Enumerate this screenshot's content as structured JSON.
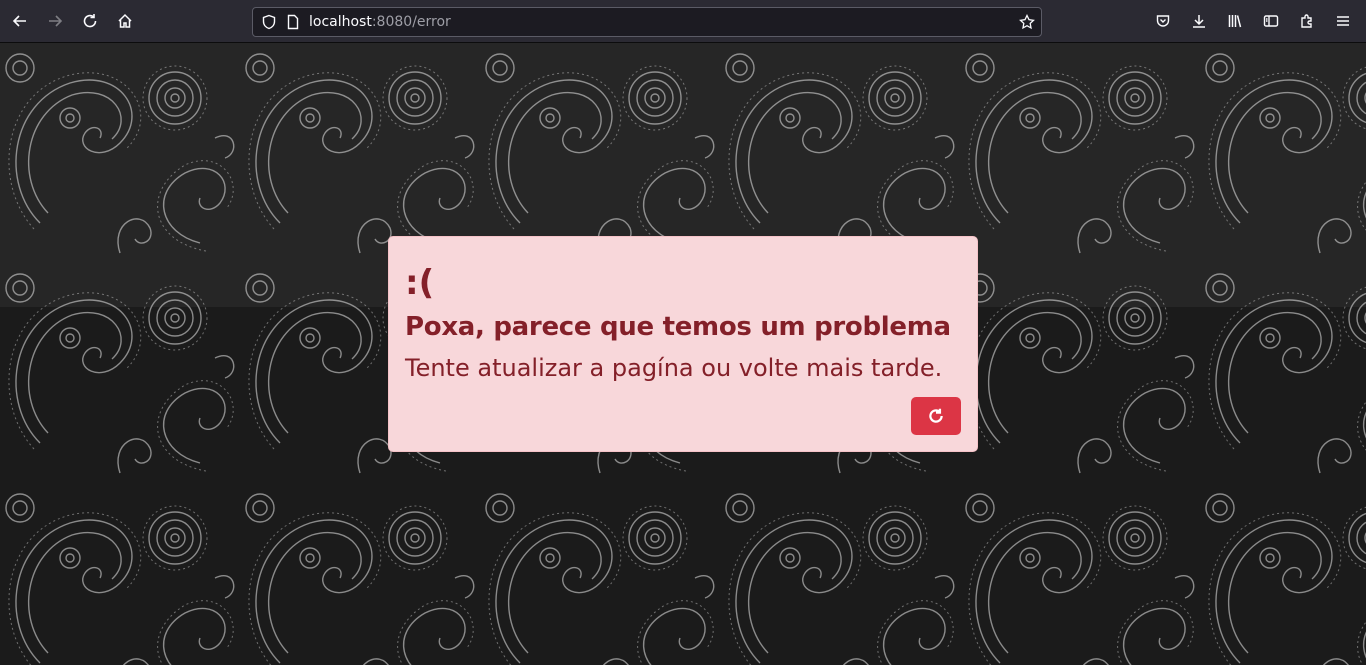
{
  "browser": {
    "url_host": "localhost",
    "url_rest": ":8080/error",
    "icons": [
      "back-icon",
      "forward-icon",
      "reload-icon",
      "home-icon",
      "shield-icon",
      "page-icon",
      "star-icon",
      "pocket-icon",
      "download-icon",
      "library-icon",
      "sidebar-icon",
      "extensions-icon",
      "menu-icon"
    ]
  },
  "error": {
    "face": ":(",
    "title": "Poxa, parece que temos um problema",
    "message": "Tente atualizar a pagína ou volte mais tarde.",
    "button_icon": "refresh-icon"
  },
  "colors": {
    "alert_bg": "#f8d7da",
    "alert_text": "#842029",
    "button_bg": "#dc3545",
    "page_bg": "#181818"
  }
}
